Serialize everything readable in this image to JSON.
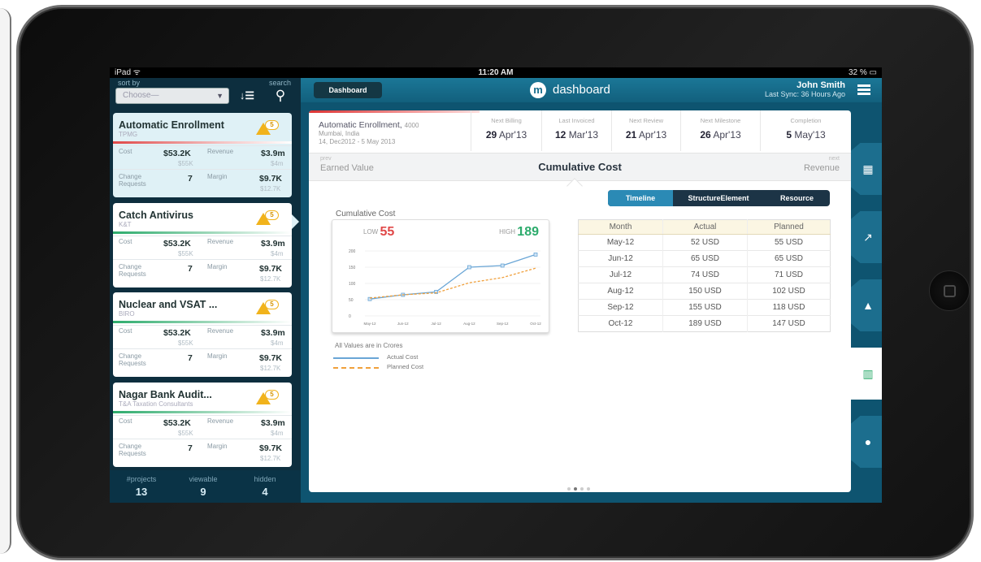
{
  "status_bar": {
    "device": "iPad ᯤ",
    "time": "11:20 AM",
    "battery": "32 % ▭"
  },
  "sidebar": {
    "sort_label": "sort by",
    "search_label": "search",
    "choose_placeholder": "Choose—",
    "projects": [
      {
        "title": "Automatic Enrollment",
        "client": "TPMG",
        "alerts": "5",
        "cost_label": "Cost",
        "cost": "$53.2K",
        "cost_planned": "$55K",
        "revenue_label": "Revenue",
        "revenue": "$3.9m",
        "revenue_planned": "$4m",
        "change_label": "Change Requests",
        "change": "7",
        "margin_label": "Margin",
        "margin": "$9.7K",
        "margin_planned": "$12.7K"
      },
      {
        "title": "Catch Antivirus",
        "client": "K&T",
        "alerts": "5",
        "cost_label": "Cost",
        "cost": "$53.2K",
        "cost_planned": "$55K",
        "revenue_label": "Revenue",
        "revenue": "$3.9m",
        "revenue_planned": "$4m",
        "change_label": "Change Requests",
        "change": "7",
        "margin_label": "Margin",
        "margin": "$9.7K",
        "margin_planned": "$12.7K"
      },
      {
        "title": "Nuclear and VSAT ...",
        "client": "BIRO",
        "alerts": "5",
        "cost_label": "Cost",
        "cost": "$53.2K",
        "cost_planned": "$55K",
        "revenue_label": "Revenue",
        "revenue": "$3.9m",
        "revenue_planned": "$4m",
        "change_label": "Change Requests",
        "change": "7",
        "margin_label": "Margin",
        "margin": "$9.7K",
        "margin_planned": "$12.7K"
      },
      {
        "title": "Nagar Bank Audit...",
        "client": "T&A Taxation Consultants",
        "alerts": "5",
        "cost_label": "Cost",
        "cost": "$53.2K",
        "cost_planned": "$55K",
        "revenue_label": "Revenue",
        "revenue": "$3.9m",
        "revenue_planned": "$4m",
        "change_label": "Change Requests",
        "change": "7",
        "margin_label": "Margin",
        "margin": "$9.7K",
        "margin_planned": "$12.7K"
      }
    ],
    "footer": [
      {
        "label": "#projects",
        "value": "13"
      },
      {
        "label": "viewable",
        "value": "9"
      },
      {
        "label": "hidden",
        "value": "4"
      }
    ]
  },
  "topbar": {
    "back_label": "Dashboard",
    "logo": "m",
    "title": "dashboard",
    "user_name": "John Smith",
    "sync": "Last Sync: 36 Hours Ago"
  },
  "project_header": {
    "title": "Automatic Enrollment,",
    "code": "4000",
    "location": "Mumbai, India",
    "dates": "14, Dec2012 - 5 May 2013",
    "milestones": [
      {
        "label": "Next Billing",
        "day": "29",
        "month": "Apr'13"
      },
      {
        "label": "Last Invoiced",
        "day": "12",
        "month": "Mar'13"
      },
      {
        "label": "Next Review",
        "day": "21",
        "month": "Apr'13"
      },
      {
        "label": "Next Milestone",
        "day": "26",
        "month": "Apr'13"
      },
      {
        "label": "Completion",
        "day": "5",
        "month": "May'13"
      }
    ]
  },
  "subheader": {
    "prev_label": "prev",
    "prev_value": "Earned Value",
    "current": "Cumulative Cost",
    "next_label": "next",
    "next_value": "Revenue"
  },
  "segments": [
    "Timeline",
    "StructureElement",
    "Resource"
  ],
  "chart_title": "Cumulative Cost",
  "low_label": "LOW",
  "low_value": "55",
  "high_label": "HIGH",
  "high_value": "189",
  "values_note": "All Values are in Crores",
  "legend": {
    "actual": "Actual Cost",
    "planned": "Planned Cost"
  },
  "chart_data": {
    "type": "line",
    "title": "Cumulative Cost",
    "x": [
      "May-12",
      "Jun-12",
      "Jul-12",
      "Aug-12",
      "Sep-12",
      "Oct-12"
    ],
    "series": [
      {
        "name": "Actual Cost",
        "values": [
          52,
          65,
          74,
          150,
          155,
          189
        ],
        "color": "#6aa6d6"
      },
      {
        "name": "Planned Cost",
        "values": [
          55,
          65,
          71,
          102,
          118,
          147
        ],
        "color": "#f0a03c"
      }
    ],
    "ylim": [
      0,
      200
    ],
    "yticks": [
      "0",
      "50",
      "100",
      "150",
      "200"
    ],
    "xtick_labels": [
      "May-12",
      "Jun-12",
      "Jul-12",
      "Aug-12",
      "Sep-12",
      "Oct-12"
    ]
  },
  "table": {
    "headers": [
      "Month",
      "Actual",
      "Planned"
    ],
    "rows": [
      [
        "May-12",
        "52 USD",
        "55 USD"
      ],
      [
        "Jun-12",
        "65 USD",
        "65 USD"
      ],
      [
        "Jul-12",
        "74 USD",
        "71 USD"
      ],
      [
        "Aug-12",
        "150 USD",
        "102 USD"
      ],
      [
        "Sep-12",
        "155 USD",
        "118 USD"
      ],
      [
        "Oct-12",
        "189 USD",
        "147 USD"
      ]
    ]
  },
  "tab_icons": [
    "grid-icon",
    "trend-icon",
    "warning-icon",
    "bar-chart-icon",
    "person-icon"
  ],
  "colors": {
    "accent": "#1b7797",
    "sidebar": "#0d2e3e",
    "high": "#2cab6c",
    "low": "#e04848"
  }
}
